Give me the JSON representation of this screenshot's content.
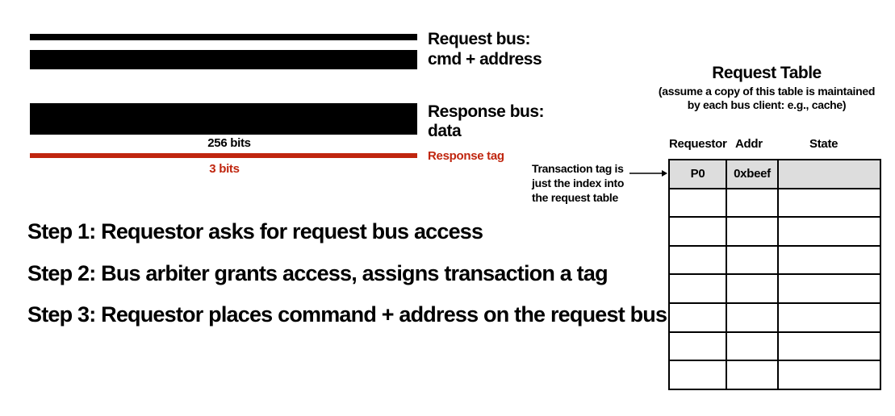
{
  "request_bus": {
    "label_line1": "Request bus:",
    "label_line2": "cmd + address"
  },
  "response_bus": {
    "label_line1": "Response bus:",
    "label_line2": "data",
    "width_label": "256 bits"
  },
  "response_tag": {
    "label": "Response tag",
    "width_label": "3 bits",
    "color": "#c0260f"
  },
  "steps": [
    "Step 1: Requestor asks for request bus access",
    "Step 2: Bus arbiter grants access, assigns transaction a tag",
    "Step 3: Requestor places command + address on the request bus"
  ],
  "request_table": {
    "title": "Request Table",
    "subtitle_line1": "(assume a copy of this table is maintained",
    "subtitle_line2": "by each bus client: e.g., cache)",
    "columns": [
      "Requestor",
      "Addr",
      "State"
    ],
    "rows": [
      [
        "P0",
        "0xbeef",
        ""
      ],
      [
        "",
        "",
        ""
      ],
      [
        "",
        "",
        ""
      ],
      [
        "",
        "",
        ""
      ],
      [
        "",
        "",
        ""
      ],
      [
        "",
        "",
        ""
      ],
      [
        "",
        "",
        ""
      ],
      [
        "",
        "",
        ""
      ]
    ]
  },
  "annotation": {
    "line1": "Transaction tag is",
    "line2": "just the index into",
    "line3": "the request table"
  }
}
